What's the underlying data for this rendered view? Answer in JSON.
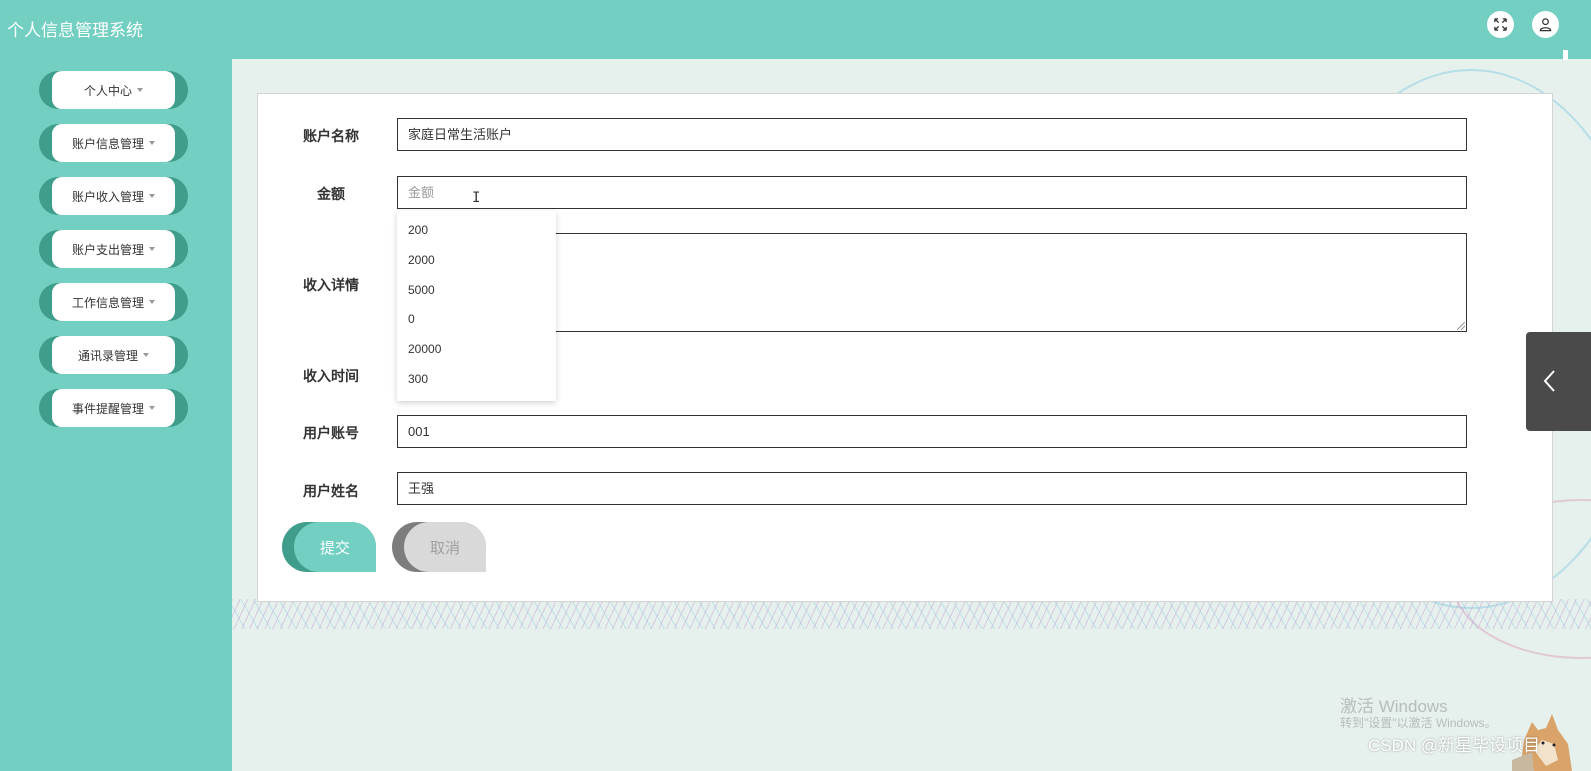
{
  "app": {
    "title": "个人信息管理系统"
  },
  "sidebar": {
    "items": [
      {
        "label": "个人中心"
      },
      {
        "label": "账户信息管理"
      },
      {
        "label": "账户收入管理"
      },
      {
        "label": "账户支出管理"
      },
      {
        "label": "工作信息管理"
      },
      {
        "label": "通讯录管理"
      },
      {
        "label": "事件提醒管理"
      }
    ]
  },
  "form": {
    "account_name": {
      "label": "账户名称",
      "value": "家庭日常生活账户"
    },
    "amount": {
      "label": "金额",
      "placeholder": "金额",
      "suggestions": [
        "200",
        "2000",
        "5000",
        "0",
        "20000",
        "300"
      ]
    },
    "income_detail": {
      "label": "收入详情",
      "value": ""
    },
    "income_time": {
      "label": "收入时间"
    },
    "user_account": {
      "label": "用户账号",
      "value": "001"
    },
    "user_name": {
      "label": "用户姓名",
      "value": "王强"
    },
    "submit_label": "提交",
    "cancel_label": "取消"
  },
  "overlay": {
    "windows_activation": "激活 Windows",
    "windows_activation_hint": "转到\"设置\"以激活 Windows。",
    "csdn_watermark": "CSDN @新星毕设项目"
  },
  "colors": {
    "primary": "#72cfc1",
    "primary_dark": "#3f9d8b",
    "background": "#e6f0ec"
  },
  "icons": {
    "fullscreen": "expand-icon",
    "user": "user-icon",
    "collapse": "chevron-left-icon"
  }
}
